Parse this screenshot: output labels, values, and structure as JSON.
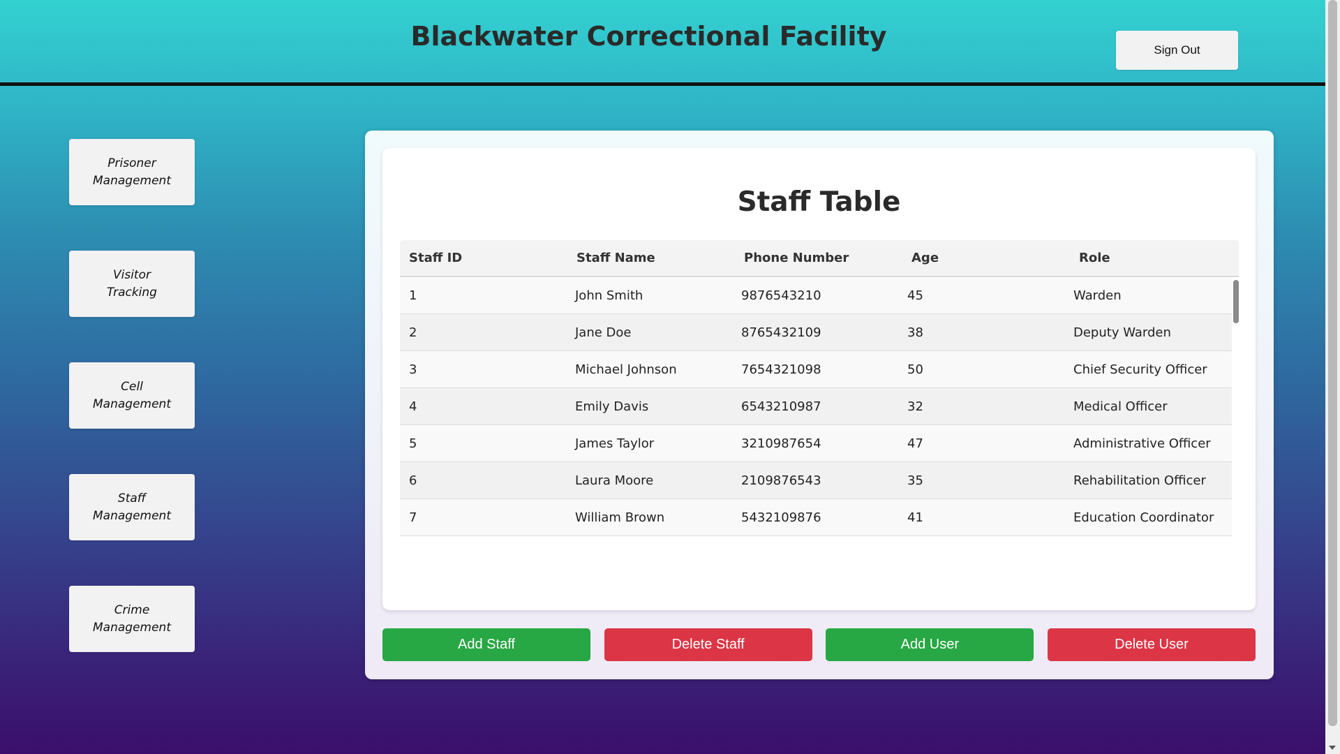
{
  "header": {
    "title": "Blackwater Correctional Facility",
    "sign_out_label": "Sign Out"
  },
  "sidebar": {
    "items": [
      {
        "label": "Prisoner Management"
      },
      {
        "label": "Visitor Tracking"
      },
      {
        "label": "Cell Management"
      },
      {
        "label": "Staff Management"
      },
      {
        "label": "Crime Management"
      }
    ]
  },
  "main": {
    "table_title": "Staff Table",
    "columns": [
      "Staff ID",
      "Staff Name",
      "Phone Number",
      "Age",
      "Role"
    ],
    "rows": [
      [
        "1",
        "John Smith",
        "9876543210",
        "45",
        "Warden"
      ],
      [
        "2",
        "Jane Doe",
        "8765432109",
        "38",
        "Deputy Warden"
      ],
      [
        "3",
        "Michael Johnson",
        "7654321098",
        "50",
        "Chief Security Officer"
      ],
      [
        "4",
        "Emily Davis",
        "6543210987",
        "32",
        "Medical Officer"
      ],
      [
        "5",
        "James Taylor",
        "3210987654",
        "47",
        "Administrative Officer"
      ],
      [
        "6",
        "Laura Moore",
        "2109876543",
        "35",
        "Rehabilitation Officer"
      ],
      [
        "7",
        "William Brown",
        "5432109876",
        "41",
        "Education Coordinator"
      ]
    ],
    "actions": {
      "add_staff": "Add Staff",
      "delete_staff": "Delete Staff",
      "add_user": "Add User",
      "delete_user": "Delete User"
    }
  },
  "colors": {
    "add": "#28a745",
    "delete": "#dc3545",
    "gradient_top": "#33d1d0",
    "gradient_bottom": "#3a0f6b"
  }
}
